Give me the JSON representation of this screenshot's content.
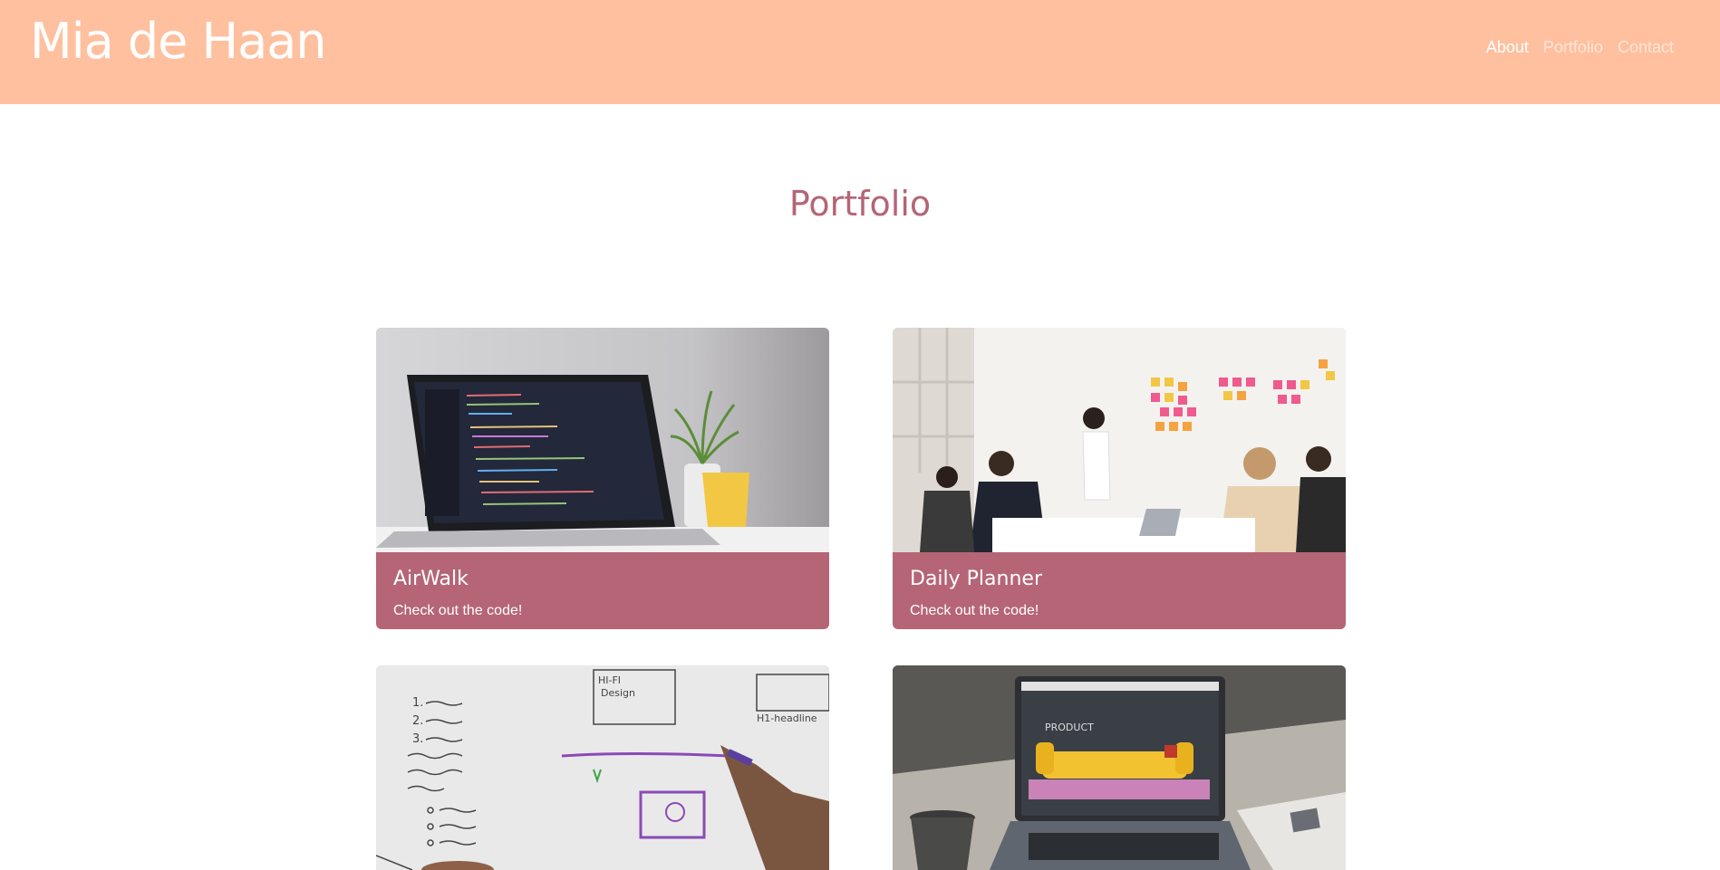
{
  "brand": "Mia de Haan",
  "nav": {
    "about": "About",
    "portfolio": "Portfolio",
    "contact": "Contact"
  },
  "section": {
    "title": "Portfolio"
  },
  "projects": [
    {
      "name": "AirWalk",
      "link_text": "Check out the code!",
      "image": "laptop-with-code-photo"
    },
    {
      "name": "Daily Planner",
      "link_text": "Check out the code!",
      "image": "team-meeting-sticky-notes-photo"
    },
    {
      "name": "",
      "link_text": "",
      "image": "whiteboard-sketch-photo"
    },
    {
      "name": "",
      "link_text": "",
      "image": "laptop-on-desk-photo"
    }
  ],
  "whiteboard_text": {
    "hifi": "HI-FI\nDesign",
    "h1": "H1-headline"
  },
  "desk_screen_text": "PRODUCT",
  "colors": {
    "header_bg": "#ffc09f",
    "accent": "#b56576",
    "text_on_accent": "#ffffff"
  }
}
